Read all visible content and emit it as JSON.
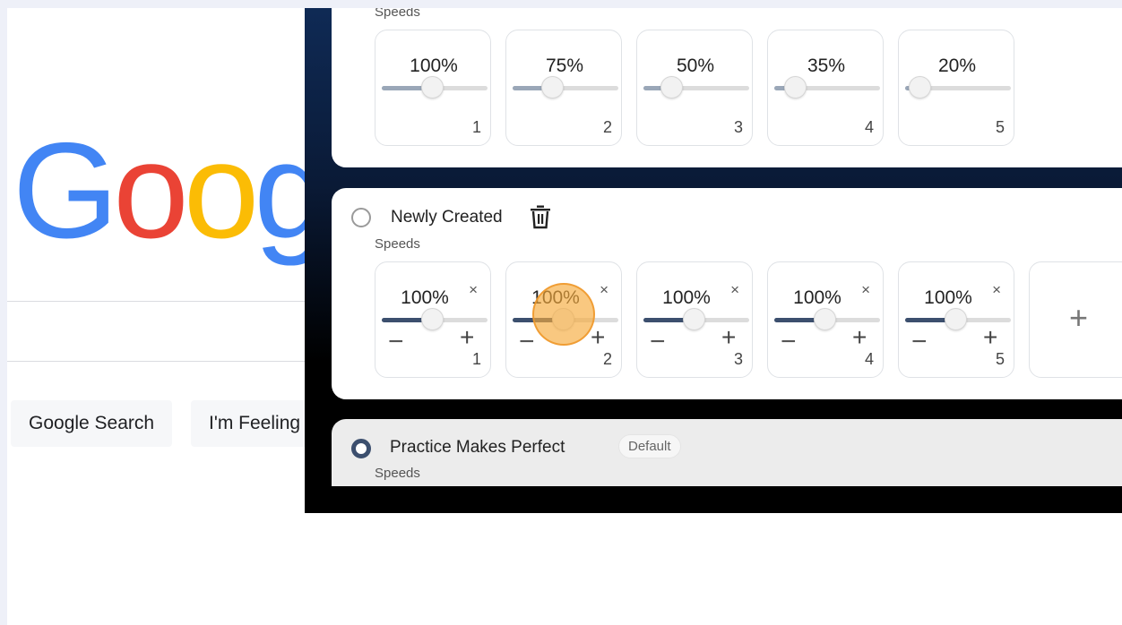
{
  "google": {
    "logo_letters": [
      "G",
      "o",
      "o",
      "g"
    ],
    "logo_colors": [
      "#4285F4",
      "#EA4335",
      "#FBBC05",
      "#4285F4"
    ],
    "search_button": "Google Search",
    "lucky_button": "I'm Feeling"
  },
  "colors": {
    "accent_fill_light": "#9aa7b8",
    "accent_fill_dark": "#3c4f6e",
    "cursor_highlight": "#f6aa3c"
  },
  "profiles": [
    {
      "speeds_label": "Speeds",
      "speeds": [
        {
          "value": "100%",
          "index": "1",
          "fill": 0.48
        },
        {
          "value": "75%",
          "index": "2",
          "fill": 0.38
        },
        {
          "value": "50%",
          "index": "3",
          "fill": 0.27
        },
        {
          "value": "35%",
          "index": "4",
          "fill": 0.2
        },
        {
          "value": "20%",
          "index": "5",
          "fill": 0.14
        }
      ]
    },
    {
      "name": "Newly Created",
      "speeds_label": "Speeds",
      "remove_symbol": "×",
      "minus_symbol": "−",
      "plus_symbol": "+",
      "add_symbol": "+",
      "speeds": [
        {
          "value": "100%",
          "index": "1",
          "fill": 0.48
        },
        {
          "value": "100%",
          "index": "2",
          "fill": 0.48
        },
        {
          "value": "100%",
          "index": "3",
          "fill": 0.48
        },
        {
          "value": "100%",
          "index": "4",
          "fill": 0.48
        },
        {
          "value": "100%",
          "index": "5",
          "fill": 0.48
        }
      ]
    },
    {
      "name": "Practice Makes Perfect",
      "badge": "Default",
      "speeds_label": "Speeds"
    }
  ]
}
